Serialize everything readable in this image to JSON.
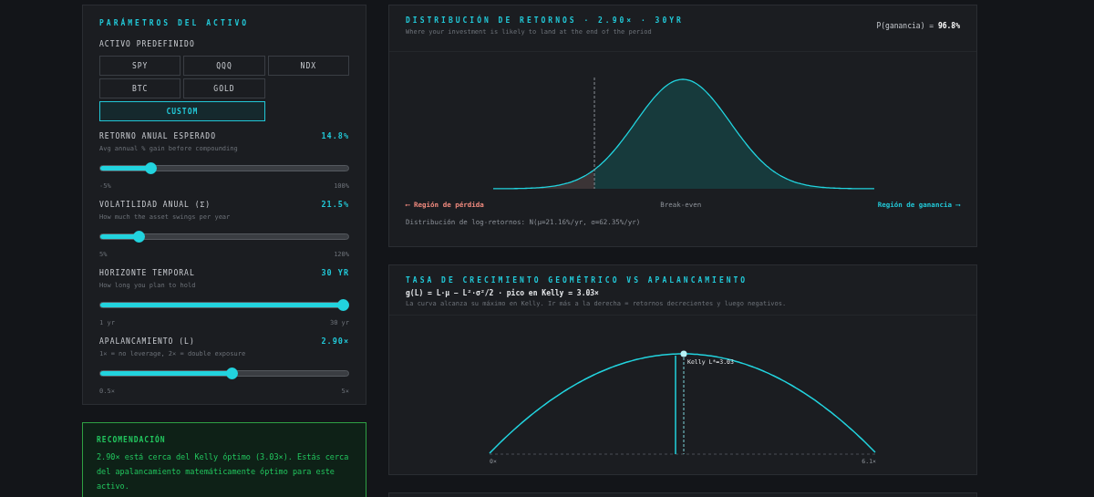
{
  "params": {
    "title": "PARÁMETROS DEL ACTIVO",
    "preset_label": "ACTIVO PREDEFINIDO",
    "presets": [
      {
        "label": "SPY",
        "selected": false
      },
      {
        "label": "QQQ",
        "selected": false
      },
      {
        "label": "NDX",
        "selected": false
      },
      {
        "label": "BTC",
        "selected": false
      },
      {
        "label": "GOLD",
        "selected": false
      },
      {
        "label": "CUSTOM",
        "selected": true
      }
    ],
    "sliders": [
      {
        "label": "RETORNO ANUAL ESPERADO",
        "value": "14.8%",
        "hint": "Avg annual % gain before compounding",
        "level": 0.19,
        "min": "-5%",
        "max": "100%"
      },
      {
        "label": "VOLATILIDAD ANUAL (Σ)",
        "value": "21.5%",
        "hint": "How much the asset swings per year",
        "level": 0.143,
        "min": "5%",
        "max": "120%"
      },
      {
        "label": "HORIZONTE TEMPORAL",
        "value": "30 YR",
        "hint": "How long you plan to hold",
        "level": 1,
        "min": "1 yr",
        "max": "30 yr"
      },
      {
        "label": "APALANCAMIENTO (L)",
        "value": "2.90×",
        "hint": "1× = no leverage, 2× = double exposure",
        "level": 0.533,
        "min": "0.5×",
        "max": "5×"
      }
    ]
  },
  "recommendation": {
    "title": "RECOMENDACIÓN",
    "text": "2.90× está cerca del Kelly óptimo (3.03×). Estás cerca del apalancamiento matemáticamente óptimo para este activo."
  },
  "distribution": {
    "title": "DISTRIBUCIÓN DE RETORNOS · 2.90× · 30YR",
    "subtitle": "Where your investment is likely to land at the end of the period",
    "probability_label": "P(ganancia) = ",
    "probability": "96.8%",
    "loss_label": "⟵ Región de pérdida",
    "breakeven_label": "Break-even",
    "gain_label": "Región de ganancia ⟶",
    "footnote": "Distribución de log-retornos: N(μ=21.16%/yr, σ=62.35%/yr)"
  },
  "growth": {
    "title": "TASA DE CRECIMIENTO GEOMÉTRICO VS APALANCAMIENTO",
    "formula": "g(L) = L·μ − L²·σ²/2 · pico en Kelly = 3.03×",
    "subtitle": "La curva alcanza su máximo en Kelly. Ir más a la derecha = retornos decrecientes y luego negativos.",
    "kelly_label": "Kelly L*=3.03",
    "x_min": "0×",
    "x_max": "6.1×"
  }
}
